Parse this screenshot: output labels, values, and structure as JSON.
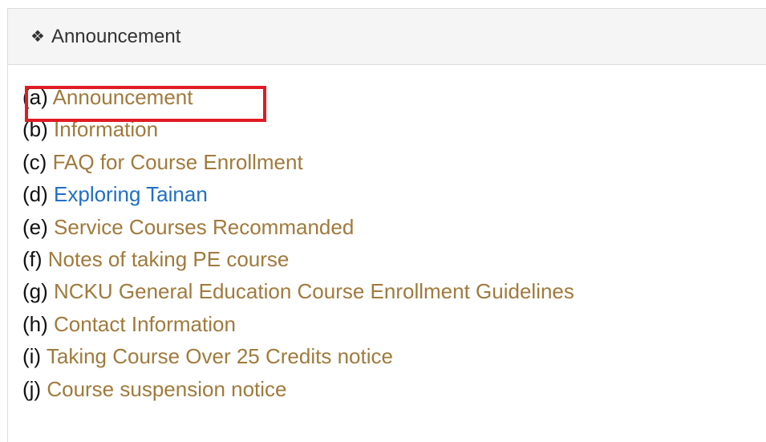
{
  "header": {
    "icon": "diamond-bullet-icon",
    "title": "Announcement"
  },
  "colors": {
    "link": "#a07a3c",
    "link_active": "#1f6fc5",
    "highlight": "#e01b24",
    "header_bg": "#f5f5f5"
  },
  "items": [
    {
      "prefix": "(a)",
      "label": "Announcement"
    },
    {
      "prefix": "(b)",
      "label": "Information"
    },
    {
      "prefix": "(c)",
      "label": "FAQ for Course Enrollment"
    },
    {
      "prefix": "(d)",
      "label": "Exploring Tainan"
    },
    {
      "prefix": "(e)",
      "label": "Service Courses Recommanded"
    },
    {
      "prefix": "(f)",
      "label": "Notes of taking PE course"
    },
    {
      "prefix": "(g)",
      "label": "NCKU General Education Course Enrollment Guidelines"
    },
    {
      "prefix": "(h)",
      "label": "Contact Information"
    },
    {
      "prefix": "(i)",
      "label": "Taking Course Over 25 Credits notice"
    },
    {
      "prefix": "(j)",
      "label": "Course suspension notice"
    }
  ]
}
